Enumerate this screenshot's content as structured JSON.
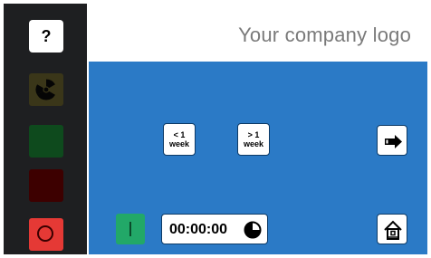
{
  "sidebar": {
    "help_label": "?",
    "icons": [
      "radiation-icon",
      "stop-circle-icon"
    ],
    "colors": {
      "background": "#1e1f21",
      "radiation_bg": "#3a3619",
      "green": "#0e4a1d",
      "dark_red": "#3d0000",
      "stop": "#e53935"
    }
  },
  "header": {
    "logo_text": "Your company logo"
  },
  "main": {
    "background": "#2b7ac6",
    "prev_week": {
      "line1": "< 1",
      "line2": "week"
    },
    "next_week": {
      "line1": "> 1",
      "line2": "week"
    },
    "timer": {
      "value": "00:00:00"
    },
    "icons": [
      "arrow-right-icon",
      "home-icon",
      "pie-clock-icon"
    ]
  }
}
